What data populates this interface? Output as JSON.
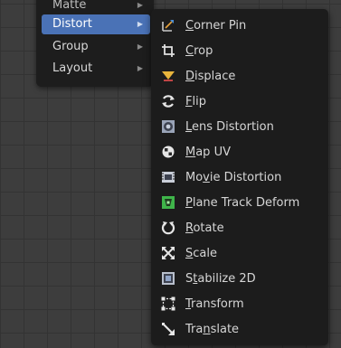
{
  "parent_menu": {
    "items": [
      {
        "label": "Matte",
        "underline": ""
      },
      {
        "label": "Distort",
        "underline": "D",
        "active": true
      },
      {
        "label": "Group",
        "underline": "G"
      },
      {
        "label": "Layout",
        "underline": "L"
      }
    ],
    "submenu_arrow": "▶"
  },
  "distort_menu": {
    "items": [
      {
        "pre": "",
        "ul": "C",
        "post": "orner Pin",
        "icon": "corner-pin-icon"
      },
      {
        "pre": "",
        "ul": "C",
        "post": "rop",
        "icon": "crop-icon"
      },
      {
        "pre": "",
        "ul": "D",
        "post": "isplace",
        "icon": "displace-icon"
      },
      {
        "pre": "",
        "ul": "F",
        "post": "lip",
        "icon": "flip-icon"
      },
      {
        "pre": "",
        "ul": "L",
        "post": "ens Distortion",
        "icon": "lens-distortion-icon"
      },
      {
        "pre": "",
        "ul": "M",
        "post": "ap UV",
        "icon": "map-uv-icon"
      },
      {
        "pre": "Mo",
        "ul": "v",
        "post": "ie Distortion",
        "icon": "movie-distortion-icon"
      },
      {
        "pre": "",
        "ul": "P",
        "post": "lane Track Deform",
        "icon": "plane-track-icon"
      },
      {
        "pre": "",
        "ul": "R",
        "post": "otate",
        "icon": "rotate-icon"
      },
      {
        "pre": "",
        "ul": "S",
        "post": "cale",
        "icon": "scale-icon"
      },
      {
        "pre": "S",
        "ul": "t",
        "post": "abilize 2D",
        "icon": "stabilize-icon"
      },
      {
        "pre": "",
        "ul": "T",
        "post": "ransform",
        "icon": "transform-icon"
      },
      {
        "pre": "Tra",
        "ul": "n",
        "post": "slate",
        "icon": "translate-icon"
      }
    ]
  },
  "colors": {
    "accent": "#4a72b6",
    "menu_bg": "#1c1c1c",
    "text": "#d6d6d6"
  }
}
